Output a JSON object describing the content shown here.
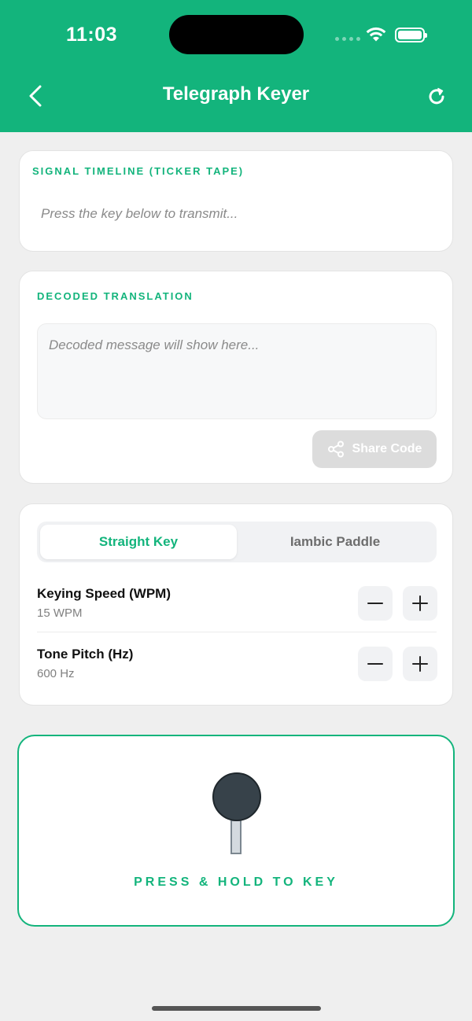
{
  "status_bar": {
    "time": "11:03"
  },
  "header": {
    "title": "Telegraph Keyer"
  },
  "signal_timeline": {
    "label": "SIGNAL TIMELINE (TICKER TAPE)",
    "placeholder": "Press the key below to transmit..."
  },
  "decoded": {
    "label": "DECODED TRANSLATION",
    "placeholder": "Decoded message will show here...",
    "share_label": "Share Code"
  },
  "mode": {
    "options": [
      "Straight Key",
      "Iambic Paddle"
    ],
    "selected": "Straight Key"
  },
  "settings": {
    "speed": {
      "name": "Keying Speed (WPM)",
      "value": "15 WPM"
    },
    "pitch": {
      "name": "Tone Pitch (Hz)",
      "value": "600 Hz"
    }
  },
  "key": {
    "label": "PRESS & HOLD TO KEY"
  },
  "colors": {
    "accent": "#13b47c",
    "background": "#efefef"
  },
  "icons": [
    "back-chevron-icon",
    "refresh-icon",
    "share-icon",
    "minus-icon",
    "plus-icon",
    "wifi-icon",
    "battery-icon"
  ]
}
